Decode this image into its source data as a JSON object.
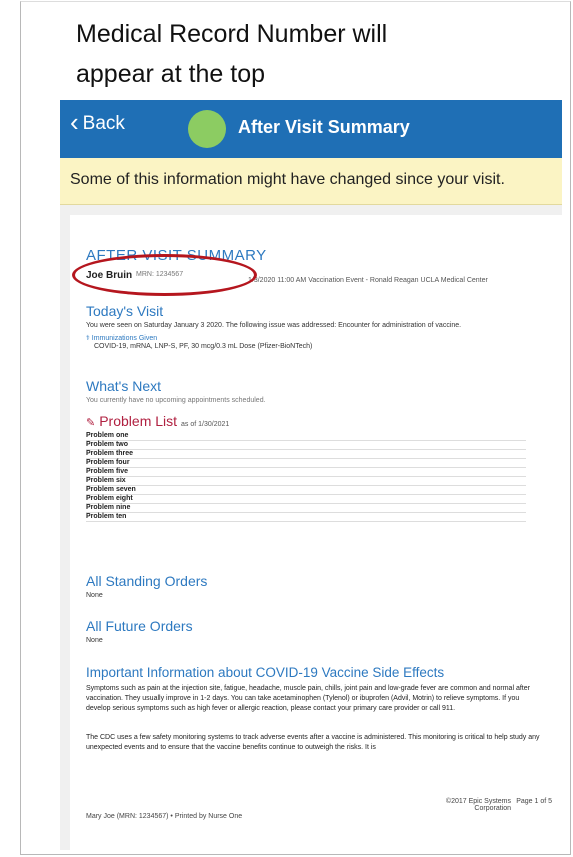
{
  "caption": {
    "line1": "Medical Record Number will",
    "line2": "appear at the top"
  },
  "nav": {
    "back_label": "Back",
    "title": "After Visit Summary"
  },
  "notice": "Some of this information might have changed since your visit.",
  "doc": {
    "heading": "AFTER VISIT SUMMARY",
    "patient_name": "Joe Bruin",
    "mrn": "MRN: 1234567",
    "visit_info": "1/3/2020 11:00 AM  Vaccination Event - Ronald Reagan UCLA Medical Center",
    "todays_visit": {
      "title": "Today's Visit",
      "text": "You were seen on Saturday January 3 2020. The following issue was addressed: Encounter for administration of vaccine.",
      "immunizations_label": "Immunizations Given",
      "immunization": "COVID-19, mRNA, LNP-S, PF, 30 mcg/0.3 mL Dose (Pfizer-BioNTech)"
    },
    "whats_next": {
      "title": "What's Next",
      "text": "You currently have no upcoming appointments scheduled."
    },
    "problem_list": {
      "title": "Problem List",
      "date": "as of 1/30/2021",
      "items": [
        "Problem one",
        "Problem two",
        "Problem three",
        "Problem four",
        "Problem five",
        "Problem six",
        "Problem seven",
        "Problem eight",
        "Problem nine",
        "Problem ten"
      ]
    },
    "standing_orders": {
      "title": "All Standing Orders",
      "text": "None"
    },
    "future_orders": {
      "title": "All Future Orders",
      "text": "None"
    },
    "covid_info": {
      "title": "Important Information about COVID-19 Vaccine Side Effects",
      "p1": "Symptoms such as pain at the injection site, fatigue, headache, muscle pain, chills, joint pain and low-grade fever are common and normal after vaccination. They usually improve in 1-2 days. You can take acetaminophen (Tylenol) or ibuprofen (Advil, Motrin) to relieve symptoms. If you develop serious symptoms such as high fever or allergic reaction, please contact your primary care provider or call 911.",
      "p2": "The CDC uses a few safety monitoring systems to track adverse events after a vaccine is administered. This monitoring is critical to help study any unexpected events and to ensure that the vaccine benefits continue to outweigh the risks. It is"
    },
    "footer": {
      "printed": "Mary Joe (MRN: 1234567) • Printed by Nurse One",
      "copyright": "©2017 Epic Systems Corporation",
      "page": "Page 1 of 5"
    }
  },
  "colors": {
    "nav_bg": "#1f6fb5",
    "notice_bg": "#fbf4c4",
    "heading_blue": "#2d79c0",
    "oval_red": "#b5161e",
    "avatar_green": "#8ccc62"
  }
}
